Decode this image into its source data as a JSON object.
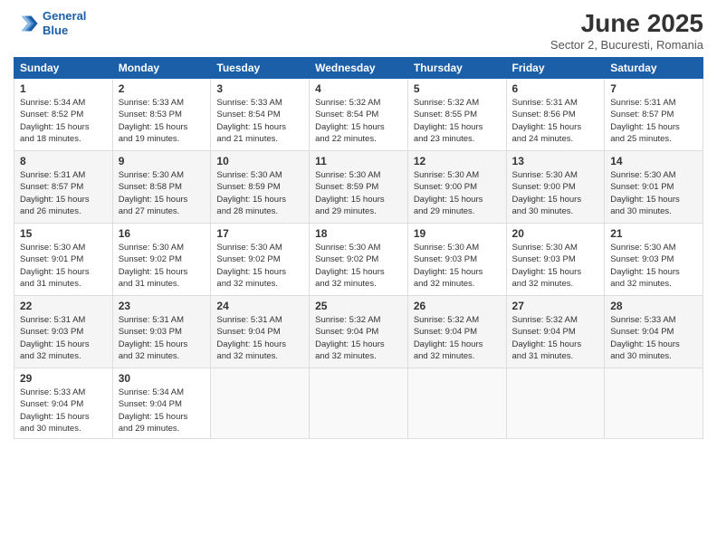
{
  "header": {
    "logo_line1": "General",
    "logo_line2": "Blue",
    "title": "June 2025",
    "subtitle": "Sector 2, Bucuresti, Romania"
  },
  "weekdays": [
    "Sunday",
    "Monday",
    "Tuesday",
    "Wednesday",
    "Thursday",
    "Friday",
    "Saturday"
  ],
  "weeks": [
    [
      {
        "day": 1,
        "info": "Sunrise: 5:34 AM\nSunset: 8:52 PM\nDaylight: 15 hours\nand 18 minutes."
      },
      {
        "day": 2,
        "info": "Sunrise: 5:33 AM\nSunset: 8:53 PM\nDaylight: 15 hours\nand 19 minutes."
      },
      {
        "day": 3,
        "info": "Sunrise: 5:33 AM\nSunset: 8:54 PM\nDaylight: 15 hours\nand 21 minutes."
      },
      {
        "day": 4,
        "info": "Sunrise: 5:32 AM\nSunset: 8:54 PM\nDaylight: 15 hours\nand 22 minutes."
      },
      {
        "day": 5,
        "info": "Sunrise: 5:32 AM\nSunset: 8:55 PM\nDaylight: 15 hours\nand 23 minutes."
      },
      {
        "day": 6,
        "info": "Sunrise: 5:31 AM\nSunset: 8:56 PM\nDaylight: 15 hours\nand 24 minutes."
      },
      {
        "day": 7,
        "info": "Sunrise: 5:31 AM\nSunset: 8:57 PM\nDaylight: 15 hours\nand 25 minutes."
      }
    ],
    [
      {
        "day": 8,
        "info": "Sunrise: 5:31 AM\nSunset: 8:57 PM\nDaylight: 15 hours\nand 26 minutes."
      },
      {
        "day": 9,
        "info": "Sunrise: 5:30 AM\nSunset: 8:58 PM\nDaylight: 15 hours\nand 27 minutes."
      },
      {
        "day": 10,
        "info": "Sunrise: 5:30 AM\nSunset: 8:59 PM\nDaylight: 15 hours\nand 28 minutes."
      },
      {
        "day": 11,
        "info": "Sunrise: 5:30 AM\nSunset: 8:59 PM\nDaylight: 15 hours\nand 29 minutes."
      },
      {
        "day": 12,
        "info": "Sunrise: 5:30 AM\nSunset: 9:00 PM\nDaylight: 15 hours\nand 29 minutes."
      },
      {
        "day": 13,
        "info": "Sunrise: 5:30 AM\nSunset: 9:00 PM\nDaylight: 15 hours\nand 30 minutes."
      },
      {
        "day": 14,
        "info": "Sunrise: 5:30 AM\nSunset: 9:01 PM\nDaylight: 15 hours\nand 30 minutes."
      }
    ],
    [
      {
        "day": 15,
        "info": "Sunrise: 5:30 AM\nSunset: 9:01 PM\nDaylight: 15 hours\nand 31 minutes."
      },
      {
        "day": 16,
        "info": "Sunrise: 5:30 AM\nSunset: 9:02 PM\nDaylight: 15 hours\nand 31 minutes."
      },
      {
        "day": 17,
        "info": "Sunrise: 5:30 AM\nSunset: 9:02 PM\nDaylight: 15 hours\nand 32 minutes."
      },
      {
        "day": 18,
        "info": "Sunrise: 5:30 AM\nSunset: 9:02 PM\nDaylight: 15 hours\nand 32 minutes."
      },
      {
        "day": 19,
        "info": "Sunrise: 5:30 AM\nSunset: 9:03 PM\nDaylight: 15 hours\nand 32 minutes."
      },
      {
        "day": 20,
        "info": "Sunrise: 5:30 AM\nSunset: 9:03 PM\nDaylight: 15 hours\nand 32 minutes."
      },
      {
        "day": 21,
        "info": "Sunrise: 5:30 AM\nSunset: 9:03 PM\nDaylight: 15 hours\nand 32 minutes."
      }
    ],
    [
      {
        "day": 22,
        "info": "Sunrise: 5:31 AM\nSunset: 9:03 PM\nDaylight: 15 hours\nand 32 minutes."
      },
      {
        "day": 23,
        "info": "Sunrise: 5:31 AM\nSunset: 9:03 PM\nDaylight: 15 hours\nand 32 minutes."
      },
      {
        "day": 24,
        "info": "Sunrise: 5:31 AM\nSunset: 9:04 PM\nDaylight: 15 hours\nand 32 minutes."
      },
      {
        "day": 25,
        "info": "Sunrise: 5:32 AM\nSunset: 9:04 PM\nDaylight: 15 hours\nand 32 minutes."
      },
      {
        "day": 26,
        "info": "Sunrise: 5:32 AM\nSunset: 9:04 PM\nDaylight: 15 hours\nand 32 minutes."
      },
      {
        "day": 27,
        "info": "Sunrise: 5:32 AM\nSunset: 9:04 PM\nDaylight: 15 hours\nand 31 minutes."
      },
      {
        "day": 28,
        "info": "Sunrise: 5:33 AM\nSunset: 9:04 PM\nDaylight: 15 hours\nand 30 minutes."
      }
    ],
    [
      {
        "day": 29,
        "info": "Sunrise: 5:33 AM\nSunset: 9:04 PM\nDaylight: 15 hours\nand 30 minutes."
      },
      {
        "day": 30,
        "info": "Sunrise: 5:34 AM\nSunset: 9:04 PM\nDaylight: 15 hours\nand 29 minutes."
      },
      null,
      null,
      null,
      null,
      null
    ]
  ]
}
